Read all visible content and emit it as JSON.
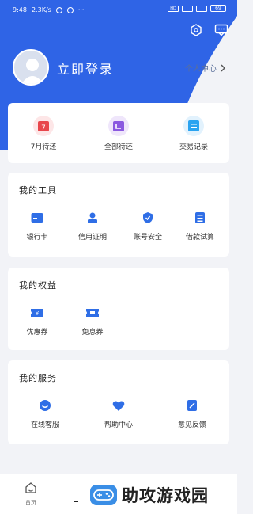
{
  "status_bar": {
    "time": "9:48",
    "speed": "2.3K/s",
    "signal_label": "HD",
    "battery": "69"
  },
  "profile": {
    "login_label": "立即登录",
    "personal_center_label": "个人中心"
  },
  "quick_actions": [
    {
      "label": "7月待还",
      "icon": "calendar-seven-icon",
      "color": "#e8464b",
      "bg": "#fde6e7"
    },
    {
      "label": "全部待还",
      "icon": "calendar-all-icon",
      "color": "#8b59e0",
      "bg": "#efe6fb"
    },
    {
      "label": "交易记录",
      "icon": "transaction-record-icon",
      "color": "#2aa3f0",
      "bg": "#e2f2fd"
    }
  ],
  "tools": {
    "title": "我的工具",
    "items": [
      {
        "label": "银行卡",
        "icon": "bank-card-icon"
      },
      {
        "label": "信用证明",
        "icon": "credit-proof-icon"
      },
      {
        "label": "账号安全",
        "icon": "account-security-icon"
      },
      {
        "label": "借款试算",
        "icon": "loan-calculator-icon"
      }
    ]
  },
  "rights": {
    "title": "我的权益",
    "items": [
      {
        "label": "优惠券",
        "icon": "coupon-icon"
      },
      {
        "label": "免息券",
        "icon": "interest-free-coupon-icon"
      }
    ]
  },
  "services": {
    "title": "我的服务",
    "items": [
      {
        "label": "在线客服",
        "icon": "online-service-icon"
      },
      {
        "label": "帮助中心",
        "icon": "help-center-icon"
      },
      {
        "label": "意见反馈",
        "icon": "feedback-icon"
      }
    ]
  },
  "bottom_nav": {
    "home_label": "首页"
  },
  "watermark": {
    "text": "助攻游戏园"
  },
  "colors": {
    "primary": "#2f64e6",
    "icon_blue": "#2f6ee6"
  }
}
